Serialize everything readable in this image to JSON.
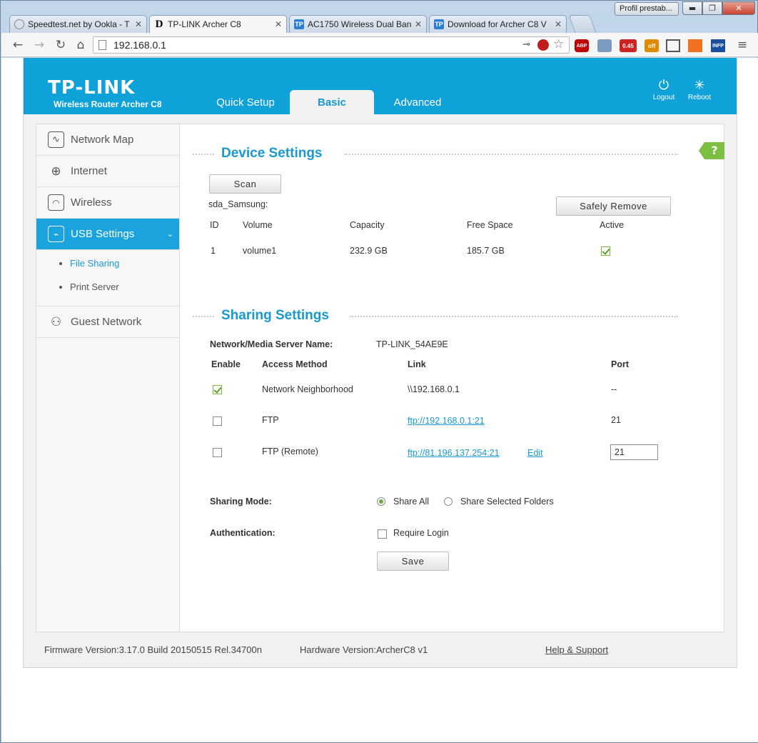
{
  "window": {
    "user_button": "Profil prestab...",
    "minimize": "▬",
    "maximize": "❐",
    "close": "✕"
  },
  "browser": {
    "tabs": [
      {
        "title": "Speedtest.net by Ookla - T",
        "active": false,
        "favicon": "speedtest-icon",
        "favicon_color": "#888888"
      },
      {
        "title": "TP-LINK Archer C8",
        "active": true,
        "favicon": "d-icon",
        "favicon_color": "#000000"
      },
      {
        "title": "AC1750 Wireless Dual Ban",
        "active": false,
        "favicon": "tp-icon",
        "favicon_color": "#2a7fd4"
      },
      {
        "title": "Download for Archer C8 V",
        "active": false,
        "favicon": "tp-icon",
        "favicon_color": "#2a7fd4"
      }
    ],
    "url": "192.168.0.1",
    "extensions": [
      {
        "name": "abp-icon",
        "label": "ABP",
        "color": "#c00000"
      },
      {
        "name": "camera-icon",
        "label": "",
        "color": "#7a9cc0"
      },
      {
        "name": "speed-meter-icon",
        "label": "0.45",
        "color": "#cc2222"
      },
      {
        "name": "ghost-off-icon",
        "label": "off",
        "color": "#e08a00"
      },
      {
        "name": "cast-icon",
        "label": "",
        "color": "#555555"
      },
      {
        "name": "chart-icon",
        "label": "",
        "color": "#f07020"
      },
      {
        "name": "infp-icon",
        "label": "INFP",
        "color": "#1a4fa0"
      }
    ]
  },
  "router": {
    "brand": "TP-LINK",
    "model": "Wireless Router Archer C8",
    "top_tabs": [
      {
        "label": "Quick Setup",
        "active": false
      },
      {
        "label": "Basic",
        "active": true
      },
      {
        "label": "Advanced",
        "active": false
      }
    ],
    "logout": "Logout",
    "reboot": "Reboot",
    "accent": "#0ea2d9"
  },
  "sidebar": {
    "items": [
      {
        "label": "Network Map",
        "icon": "network-map-icon",
        "active": false
      },
      {
        "label": "Internet",
        "icon": "globe-icon",
        "active": false
      },
      {
        "label": "Wireless",
        "icon": "wireless-icon",
        "active": false
      },
      {
        "label": "USB Settings",
        "icon": "usb-icon",
        "active": true
      },
      {
        "label": "Guest Network",
        "icon": "guest-users-icon",
        "active": false
      }
    ],
    "sub_items": [
      {
        "label": "File Sharing",
        "active": true
      },
      {
        "label": "Print Server",
        "active": false
      }
    ]
  },
  "device_settings": {
    "title": "Device Settings",
    "scan_label": "Scan",
    "device_name": "sda_Samsung:",
    "safely_remove_label": "Safely Remove",
    "columns": [
      "ID",
      "Volume",
      "Capacity",
      "Free Space",
      "Active"
    ],
    "rows": [
      {
        "id": "1",
        "volume": "volume1",
        "capacity": "232.9 GB",
        "free_space": "185.7 GB",
        "active": true
      }
    ]
  },
  "sharing_settings": {
    "title": "Sharing Settings",
    "server_name_label": "Network/Media Server Name:",
    "server_name": "TP-LINK_54AE9E",
    "columns": [
      "Enable",
      "Access Method",
      "Link",
      "Port"
    ],
    "rows": [
      {
        "enabled": true,
        "method": "Network Neighborhood",
        "link": "\\\\192.168.0.1",
        "port": "--"
      },
      {
        "enabled": false,
        "method": "FTP",
        "link": "ftp://192.168.0.1:21",
        "port": "21"
      },
      {
        "enabled": false,
        "method": "FTP (Remote)",
        "link": "ftp://81.196.137.254:21",
        "edit": "Edit",
        "port": "21"
      }
    ],
    "sharing_mode_label": "Sharing Mode:",
    "share_all": "Share All",
    "share_selected": "Share Selected Folders",
    "share_all_selected": true,
    "authentication_label": "Authentication:",
    "require_login": "Require Login",
    "require_login_checked": false,
    "save_label": "Save"
  },
  "footer": {
    "firmware": "Firmware Version:3.17.0 Build 20150515 Rel.34700n",
    "hardware": "Hardware Version:ArcherC8 v1",
    "help_support": "Help & Support"
  }
}
